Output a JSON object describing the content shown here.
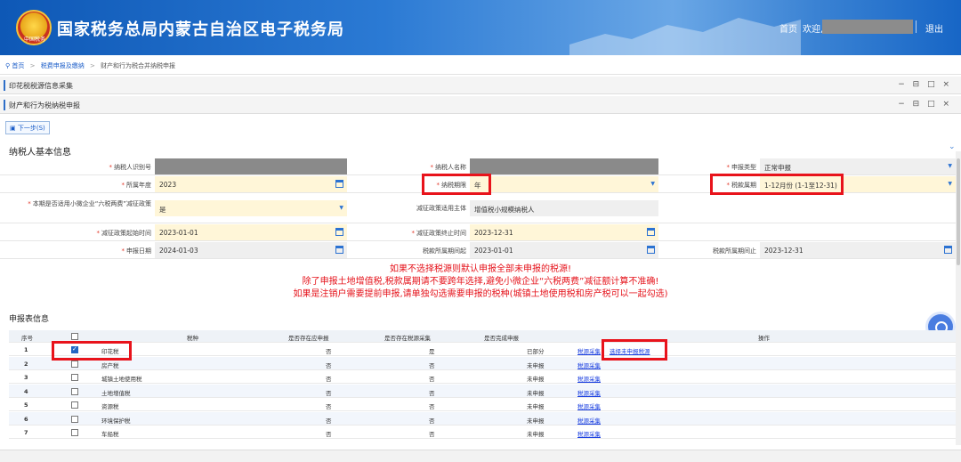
{
  "header": {
    "title": "国家税务总局内蒙古自治区电子税务局",
    "emblem_text": "中国税务",
    "home": "首页",
    "welcome": "欢迎,",
    "logout": "退出"
  },
  "breadcrumb": {
    "home": "首页",
    "level1": "税费申报及缴纳",
    "level2": "财产和行为税合并纳税申报"
  },
  "panels": {
    "panel1": "印花税税源信息采集",
    "panel2": "财产和行为税纳税申报",
    "win_controls": "− ⊟ □ ×"
  },
  "toolbar": {
    "next_label": "下一步(S)"
  },
  "basic_info": {
    "title": "纳税人基本信息",
    "taxpayer_id_label": "纳税人识别号",
    "taxpayer_name_label": "纳税人名称",
    "declare_type_label": "申报类型",
    "declare_type": "正常申报",
    "year_label": "所属年度",
    "year": "2023",
    "period_label": "纳税期限",
    "period": "年",
    "tax_period_label": "税款属期",
    "tax_period": "1-12月份 (1-1至12-31)",
    "policy_label": "本期是否适用小微企业“六税两费”减征政策",
    "policy": "是",
    "subject_label": "减征政策适用主体",
    "subject": "增值税小规模纳税人",
    "start_label": "减征政策起始时间",
    "start": "2023-01-01",
    "end_label": "减征政策终止时间",
    "end": "2023-12-31",
    "decl_date_label": "申报日期",
    "decl_date": "2024-01-03",
    "p_start_label": "税款所属期间起",
    "p_start": "2023-01-01",
    "p_end_label": "税款所属期间止",
    "p_end": "2023-12-31"
  },
  "notice": [
    "如果不选择税源则默认申报全部未申报的税源!",
    "除了申报土地增值税,税款属期请不要跨年选择,避免小微企业“六税两费”减征额计算不准确!",
    "如果是注销户需要提前申报,请单独勾选需要申报的税种(城镇土地使用税和房产税可以一起勾选)"
  ],
  "table": {
    "title": "申报表信息",
    "headers": {
      "index": "序号",
      "tax": "税种",
      "should": "是否存在应申报",
      "source": "是否存在税源采集",
      "done": "是否完成申报",
      "op": "操作"
    },
    "rows": [
      {
        "index": "1",
        "tax": "印花税",
        "should": "否",
        "source": "是",
        "done": "已部分",
        "op1": "税源采集",
        "op2": "选择未申报税源",
        "checked": true
      },
      {
        "index": "2",
        "tax": "房产税",
        "should": "否",
        "source": "否",
        "done": "未申报",
        "op1": "税源采集",
        "op2": "",
        "checked": false
      },
      {
        "index": "3",
        "tax": "城镇土地使用税",
        "should": "否",
        "source": "否",
        "done": "未申报",
        "op1": "税源采集",
        "op2": "",
        "checked": false
      },
      {
        "index": "4",
        "tax": "土地增值税",
        "should": "否",
        "source": "否",
        "done": "未申报",
        "op1": "税源采集",
        "op2": "",
        "checked": false
      },
      {
        "index": "5",
        "tax": "资源税",
        "should": "否",
        "source": "否",
        "done": "未申报",
        "op1": "税源采集",
        "op2": "",
        "checked": false
      },
      {
        "index": "6",
        "tax": "环境保护税",
        "should": "否",
        "source": "否",
        "done": "未申报",
        "op1": "税源采集",
        "op2": "",
        "checked": false
      },
      {
        "index": "7",
        "tax": "车船税",
        "should": "否",
        "source": "否",
        "done": "未申报",
        "op1": "税源采集",
        "op2": "",
        "checked": false
      }
    ]
  }
}
